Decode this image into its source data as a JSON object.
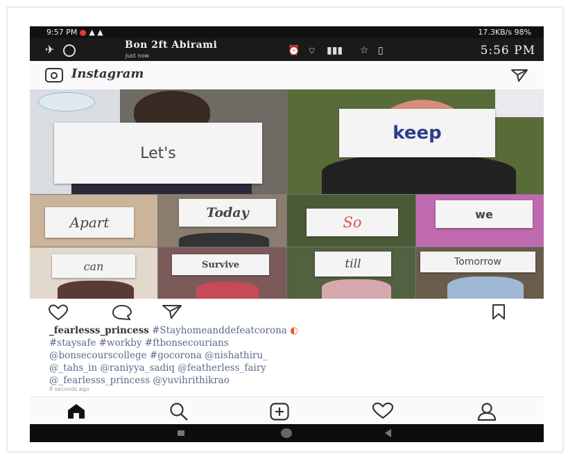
{
  "status_bar": {
    "left_time": "9:57 PM",
    "right_info": "17.3KB/s  98%",
    "clock": "5:56 PM"
  },
  "notification": {
    "title": "Bon 2ft Abirami",
    "subtitle": "Just now"
  },
  "header": {
    "app_name": "Instagram"
  },
  "collage": {
    "words": [
      "Let's",
      "keep",
      "Apart",
      "Today",
      "So",
      "we",
      "can",
      "Survive",
      "till",
      "Tomorrow"
    ]
  },
  "post": {
    "username": "_fearlesss_princess",
    "caption_lines": [
      "#Stayhomeanddefeatcorona",
      "#staysafe #workby #ftbonsecourians",
      "@bonsecourscollege #gocorona @nishathiru_",
      "@_tahs_in @raniyya_sadiq @featherless_fairy",
      "@_fearlesss_princess @yuvihrithikrao"
    ],
    "time_ago": "8 seconds ago"
  },
  "colors": {
    "accent_blue": "#2c3e8a",
    "accent_red": "#d9534f",
    "dark": "#111111"
  },
  "icons": [
    "camera-icon",
    "direct-send-icon",
    "heart-icon",
    "comment-icon",
    "share-icon",
    "bookmark-icon",
    "home-icon",
    "search-icon",
    "add-icon",
    "activity-icon",
    "profile-icon"
  ]
}
